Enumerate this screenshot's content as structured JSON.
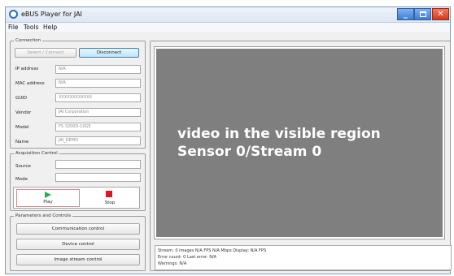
{
  "window": {
    "title": "eBUS Player for JAI",
    "icon": "ebus-app-icon",
    "controls": [
      "minimize-icon",
      "maximize-icon",
      "close-icon"
    ]
  },
  "menu": {
    "file": "File",
    "tools": "Tools",
    "help": "Help"
  },
  "connection": {
    "legend": "Connection",
    "select_connect": "Select / Connect",
    "disconnect": "Disconnect",
    "fields": [
      {
        "label": "IP address",
        "value": "N/A"
      },
      {
        "label": "MAC address",
        "value": "N/A"
      },
      {
        "label": "GUID",
        "value": "XXXXXXXXXXXX"
      },
      {
        "label": "Vendor",
        "value": "JAI Corporation"
      },
      {
        "label": "Model",
        "value": "FS-3200D-10GE"
      },
      {
        "label": "Name",
        "value": "JAI_DEMO"
      }
    ]
  },
  "acquisition": {
    "legend": "Acquisition  Control",
    "source_label": "Source",
    "source_value": "",
    "mode_label": "Mode",
    "mode_value": "",
    "play": "Play",
    "stop": "Stop"
  },
  "parameters": {
    "legend": "Parameters  and  Controls",
    "communication": "Communication  control",
    "device": "Device control",
    "image_stream": "Image stream  control"
  },
  "video": {
    "line1": "video in the visible region",
    "line2": "Sensor 0/Stream 0"
  },
  "status": {
    "line1": "Stream: 0 images   N/A FPS   N/A Mbps   Display: N/A FPS",
    "line2": "Error count: 0   Last error: N/A",
    "line3": "Warnings:  N/A"
  },
  "colors": {
    "video_bg": "#7f7f7f",
    "play": "#22b14c",
    "stop": "#e0161e",
    "close_button": "#d23a1c"
  }
}
